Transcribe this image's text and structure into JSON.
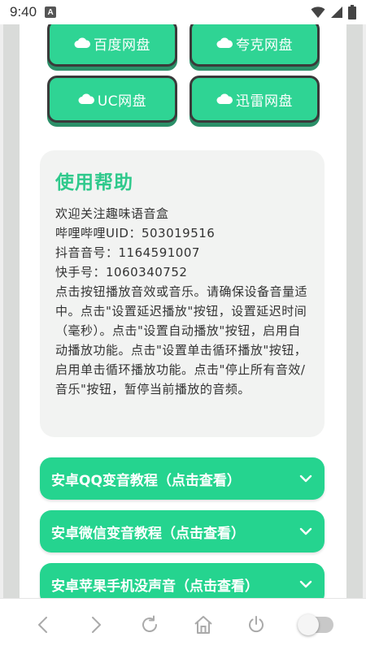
{
  "status_bar": {
    "time": "9:40",
    "notification_icon": "A"
  },
  "disk_buttons": [
    {
      "label": "百度网盘",
      "icon": "cloud-icon"
    },
    {
      "label": "夸克网盘",
      "icon": "cloud-icon"
    },
    {
      "label": "UC网盘",
      "icon": "cloud-icon"
    },
    {
      "label": "迅雷网盘",
      "icon": "cloud-icon"
    }
  ],
  "help": {
    "title": "使用帮助",
    "lines": [
      "欢迎关注趣味语音盒",
      "哔哩哔哩UID：503019516",
      "抖音音号：1164591007",
      "快手号：1060340752"
    ],
    "body": "点击按钮播放音效或音乐。请确保设备音量适中。点击\"设置延迟播放\"按钮，设置延迟时间（毫秒）。点击\"设置自动播放\"按钮，启用自动播放功能。点击\"设置单击循环播放\"按钮，启用单击循环播放功能。点击\"停止所有音效/音乐\"按钮，暂停当前播放的音频。"
  },
  "tutorials": [
    {
      "label": "安卓QQ变音教程（点击查看）"
    },
    {
      "label": "安卓微信变音教程（点击查看）"
    },
    {
      "label": "安卓苹果手机没声音（点击查看）"
    }
  ],
  "colors": {
    "accent": "#2fd494",
    "title": "#2fc98c",
    "button_shadow": "#2b8f68"
  },
  "nav_icons": [
    "back-icon",
    "forward-icon",
    "refresh-icon",
    "home-icon",
    "power-icon",
    "toggle-switch"
  ]
}
